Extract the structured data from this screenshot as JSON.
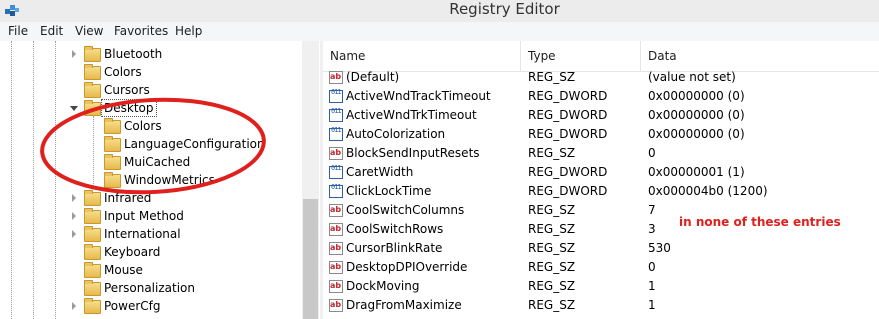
{
  "window": {
    "title": "Registry Editor"
  },
  "menu": [
    "File",
    "Edit",
    "View",
    "Favorites",
    "Help"
  ],
  "tree": {
    "items": [
      {
        "label": "Bluetooth",
        "expander": "collapsed",
        "level": 1
      },
      {
        "label": "Colors",
        "expander": "none",
        "level": 1
      },
      {
        "label": "Cursors",
        "expander": "none",
        "level": 1
      },
      {
        "label": "Desktop",
        "expander": "expanded",
        "level": 1,
        "selected": true
      },
      {
        "label": "Colors",
        "expander": "none",
        "level": 2
      },
      {
        "label": "LanguageConfiguration",
        "expander": "none",
        "level": 2
      },
      {
        "label": "MuiCached",
        "expander": "none",
        "level": 2
      },
      {
        "label": "WindowMetrics",
        "expander": "none",
        "level": 2
      },
      {
        "label": "Infrared",
        "expander": "collapsed",
        "level": 1
      },
      {
        "label": "Input Method",
        "expander": "collapsed",
        "level": 1
      },
      {
        "label": "International",
        "expander": "collapsed",
        "level": 1
      },
      {
        "label": "Keyboard",
        "expander": "none",
        "level": 1
      },
      {
        "label": "Mouse",
        "expander": "none",
        "level": 1
      },
      {
        "label": "Personalization",
        "expander": "none",
        "level": 1
      },
      {
        "label": "PowerCfg",
        "expander": "collapsed",
        "level": 1
      }
    ]
  },
  "list": {
    "columns": {
      "name": "Name",
      "type": "Type",
      "data": "Data"
    },
    "rows": [
      {
        "name": "(Default)",
        "type": "REG_SZ",
        "data": "(value not set)",
        "icon": "string-value-icon"
      },
      {
        "name": "ActiveWndTrackTimeout",
        "type": "REG_DWORD",
        "data": "0x00000000 (0)",
        "icon": "dword-value-icon"
      },
      {
        "name": "ActiveWndTrkTimeout",
        "type": "REG_DWORD",
        "data": "0x00000000 (0)",
        "icon": "dword-value-icon"
      },
      {
        "name": "AutoColorization",
        "type": "REG_DWORD",
        "data": "0x00000000 (0)",
        "icon": "dword-value-icon"
      },
      {
        "name": "BlockSendInputResets",
        "type": "REG_SZ",
        "data": "0",
        "icon": "string-value-icon"
      },
      {
        "name": "CaretWidth",
        "type": "REG_DWORD",
        "data": "0x00000001 (1)",
        "icon": "dword-value-icon"
      },
      {
        "name": "ClickLockTime",
        "type": "REG_DWORD",
        "data": "0x000004b0 (1200)",
        "icon": "dword-value-icon"
      },
      {
        "name": "CoolSwitchColumns",
        "type": "REG_SZ",
        "data": "7",
        "icon": "string-value-icon"
      },
      {
        "name": "CoolSwitchRows",
        "type": "REG_SZ",
        "data": "3",
        "icon": "string-value-icon"
      },
      {
        "name": "CursorBlinkRate",
        "type": "REG_SZ",
        "data": "530",
        "icon": "string-value-icon"
      },
      {
        "name": "DesktopDPIOverride",
        "type": "REG_SZ",
        "data": "0",
        "icon": "string-value-icon"
      },
      {
        "name": "DockMoving",
        "type": "REG_SZ",
        "data": "1",
        "icon": "string-value-icon"
      },
      {
        "name": "DragFromMaximize",
        "type": "REG_SZ",
        "data": "1",
        "icon": "string-value-icon"
      }
    ]
  },
  "annotation": {
    "text": "in none of these entries",
    "color": "#e0201d"
  },
  "icons": {
    "string_glyph": "ab",
    "dword_glyph": "011"
  }
}
